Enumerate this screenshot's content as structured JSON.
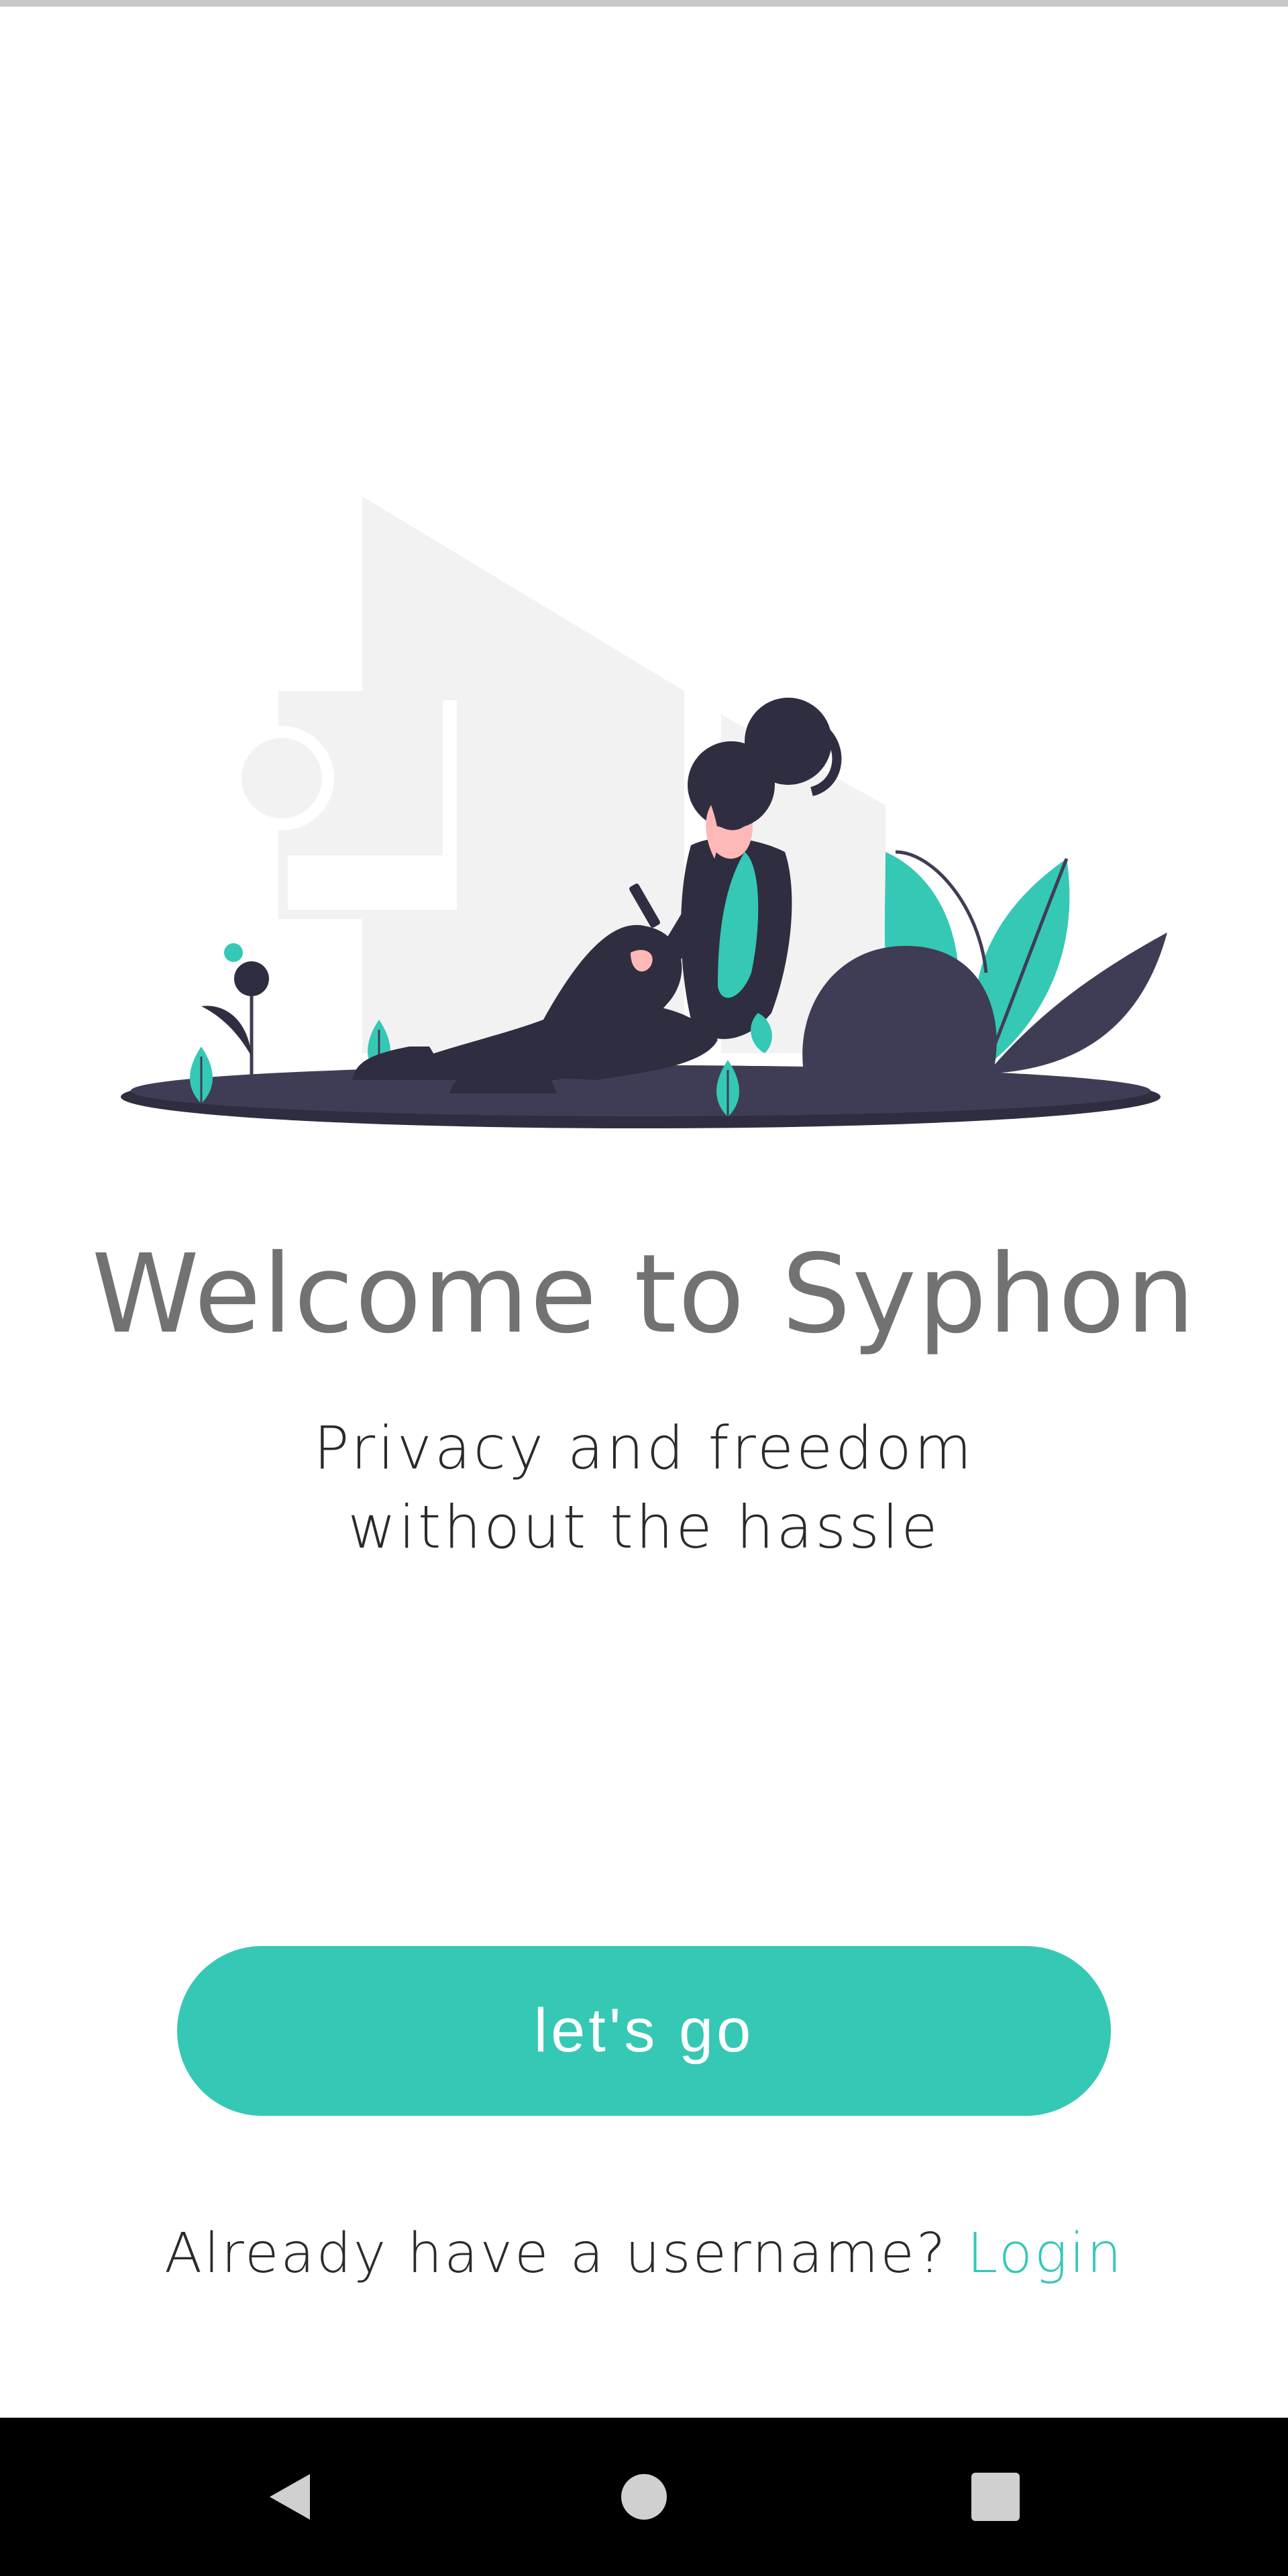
{
  "welcome": {
    "title": "Welcome to Syphon",
    "tagline_line1": "Privacy and freedom",
    "tagline_line2": "without the hassle"
  },
  "actions": {
    "primary_button_label": "let's go",
    "login_prompt": "Already have a username?",
    "login_link_label": "Login"
  },
  "colors": {
    "accent": "#35c8b5",
    "title_text": "#727272",
    "body_text": "#2a2a2e",
    "illustration_dark": "#3f3d56",
    "illustration_figure": "#2f2e41",
    "illustration_background": "#f2f2f2"
  },
  "navigation": {
    "icons": [
      "back-triangle-icon",
      "home-circle-icon",
      "recents-square-icon"
    ]
  }
}
